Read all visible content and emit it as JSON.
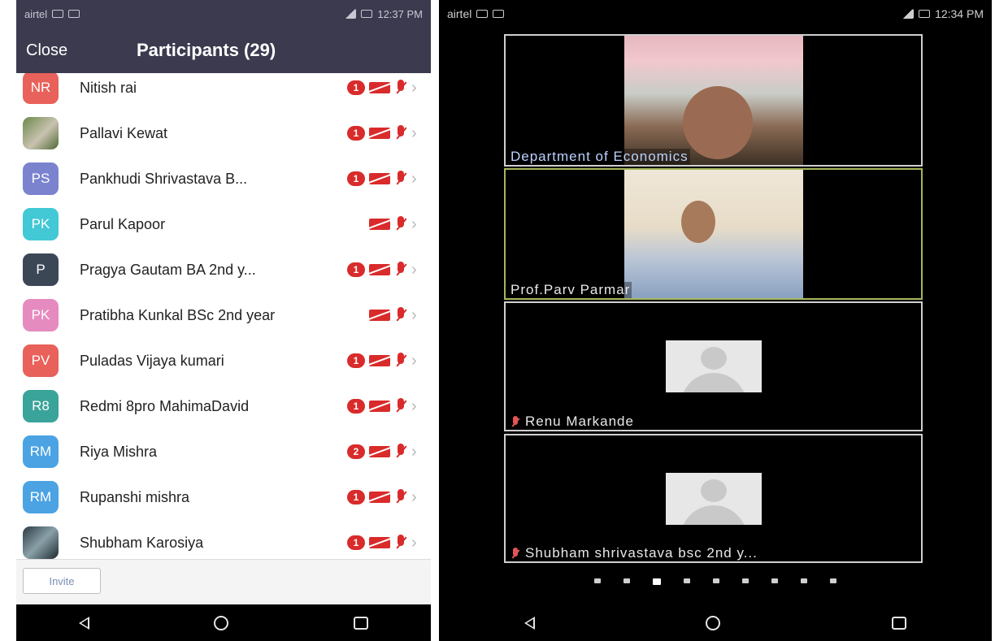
{
  "left": {
    "status": {
      "carrier": "airtel",
      "time": "12:37 PM"
    },
    "header": {
      "close_label": "Close",
      "title": "Participants (29)"
    },
    "participants": [
      {
        "initials": "NR",
        "name": "Nitish rai",
        "color": "#e8615a",
        "badge": "1",
        "photo": false
      },
      {
        "initials": "",
        "name": "Pallavi Kewat",
        "color": "",
        "badge": "1",
        "photo": true
      },
      {
        "initials": "PS",
        "name": "Pankhudi Shrivastava B...",
        "color": "#7b83cf",
        "badge": "1",
        "photo": false
      },
      {
        "initials": "PK",
        "name": "Parul Kapoor",
        "color": "#43c8d6",
        "badge": "",
        "photo": false
      },
      {
        "initials": "P",
        "name": "Pragya Gautam BA 2nd y...",
        "color": "#3c4756",
        "badge": "1",
        "photo": false
      },
      {
        "initials": "PK",
        "name": "Pratibha Kunkal BSc 2nd year",
        "color": "#e58bbf",
        "badge": "",
        "photo": false
      },
      {
        "initials": "PV",
        "name": "Puladas Vijaya kumari",
        "color": "#e8615a",
        "badge": "1",
        "photo": false
      },
      {
        "initials": "R8",
        "name": "Redmi 8pro MahimaDavid",
        "color": "#3aa39a",
        "badge": "1",
        "photo": false
      },
      {
        "initials": "RM",
        "name": "Riya Mishra",
        "color": "#4ba3e3",
        "badge": "2",
        "photo": false
      },
      {
        "initials": "RM",
        "name": "Rupanshi mishra",
        "color": "#4ba3e3",
        "badge": "1",
        "photo": false
      },
      {
        "initials": "",
        "name": "Shubham Karosiya",
        "color": "",
        "badge": "1",
        "photo": true
      }
    ],
    "footer": {
      "invite_label": "Invite"
    }
  },
  "right": {
    "status": {
      "carrier": "airtel",
      "time": "12:34 PM"
    },
    "tiles": [
      {
        "label": "Department of Economics",
        "type": "video"
      },
      {
        "label": "Prof.Parv Parmar",
        "type": "video"
      },
      {
        "label": "Renu Markande",
        "type": "placeholder"
      },
      {
        "label": "Shubham shrivastava bsc 2nd y...",
        "type": "placeholder"
      }
    ],
    "page_dots": {
      "count": 9,
      "active": 3
    }
  }
}
